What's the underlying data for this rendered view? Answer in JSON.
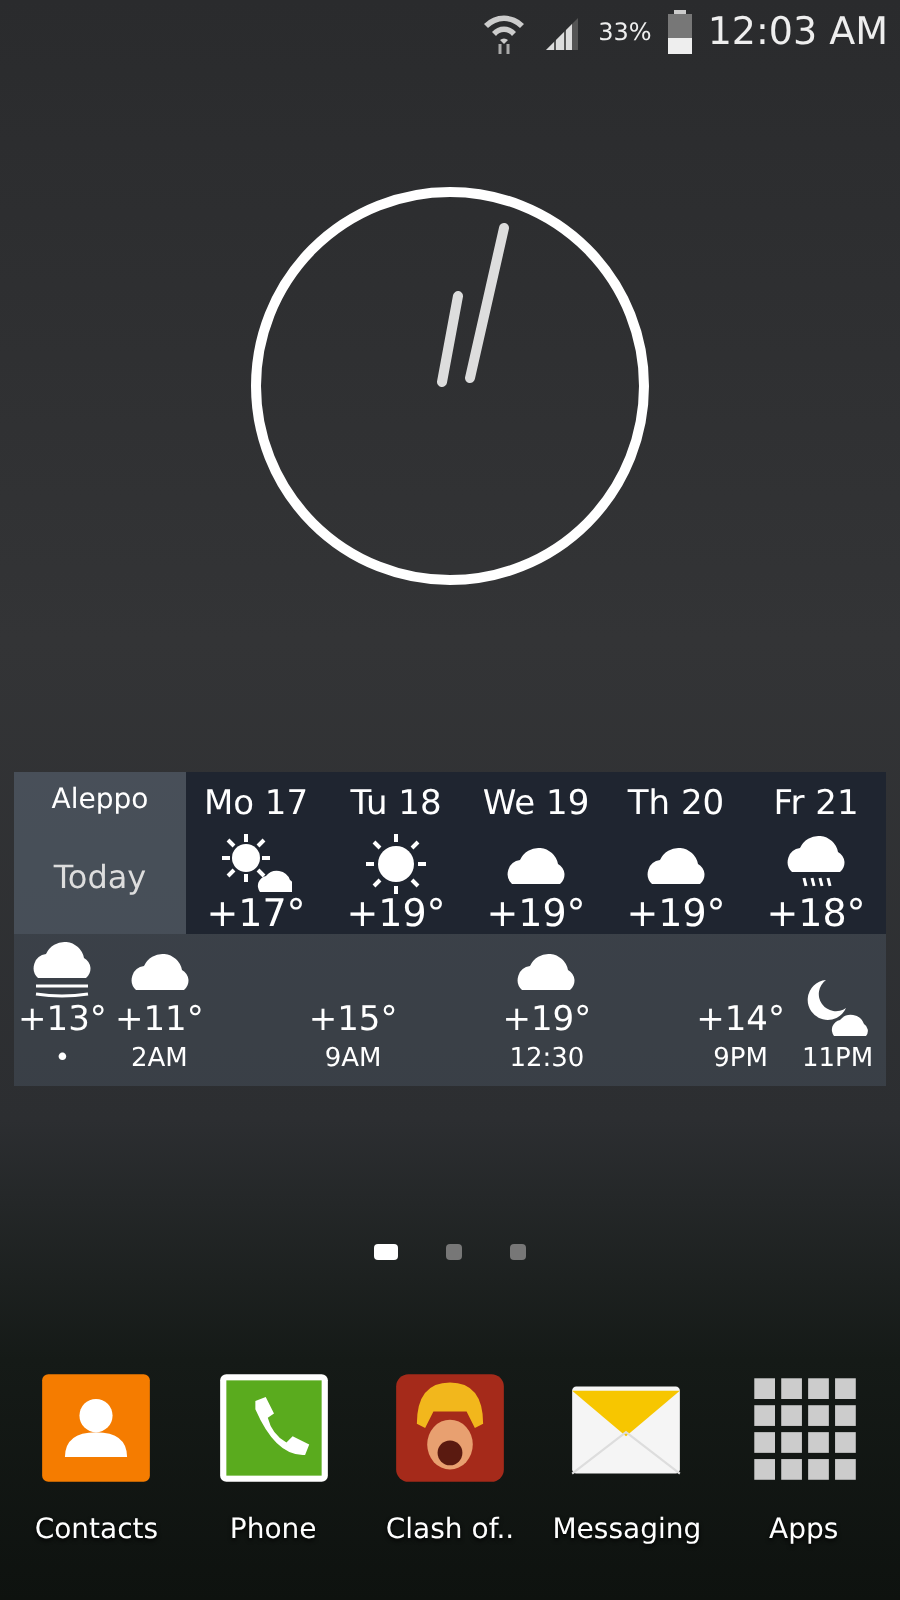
{
  "status_bar": {
    "battery": "33%",
    "time": "12:03 AM"
  },
  "weather": {
    "city": "Aleppo",
    "today": "Today",
    "days": [
      {
        "day": "Mo 17",
        "kind": "suncloud",
        "temp": "+17°"
      },
      {
        "day": "Tu 18",
        "kind": "sun",
        "temp": "+19°"
      },
      {
        "day": "We 19",
        "kind": "cloud",
        "temp": "+19°"
      },
      {
        "day": "Th 20",
        "kind": "cloud",
        "temp": "+19°"
      },
      {
        "day": "Fr 21",
        "kind": "rain",
        "temp": "+18°"
      }
    ],
    "hours": [
      {
        "kind": "fog",
        "temp": "+13°",
        "time": "•"
      },
      {
        "kind": "cloud",
        "temp": "+11°",
        "time": "2AM"
      },
      {
        "kind": "plain",
        "temp": "+15°",
        "time": "9AM"
      },
      {
        "kind": "cloud",
        "temp": "+19°",
        "time": "12:30"
      },
      {
        "kind": "plain",
        "temp": "+14°",
        "time": "9PM"
      },
      {
        "kind": "night",
        "time": "11PM"
      }
    ]
  },
  "pages": [
    {
      "selected": true
    },
    {
      "selected": false
    },
    {
      "selected": false
    }
  ],
  "dock": [
    {
      "kind": "contacts",
      "label": "Contacts"
    },
    {
      "kind": "phone",
      "label": "Phone"
    },
    {
      "kind": "game",
      "label": "Clash of.."
    },
    {
      "kind": "messaging",
      "label": "Messaging"
    },
    {
      "kind": "apps",
      "label": "Apps"
    }
  ]
}
